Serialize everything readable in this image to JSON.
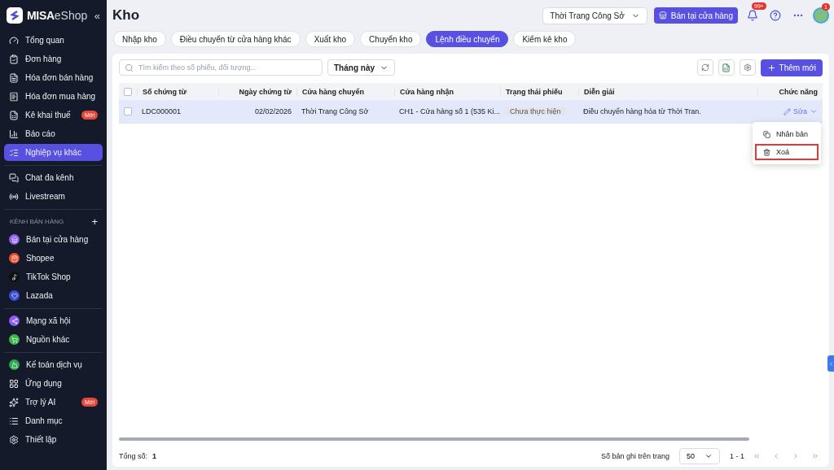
{
  "sidebar": {
    "logo": {
      "brand": "MISA",
      "product": "eShop"
    },
    "collapse": "«",
    "sections": [
      {
        "items": [
          {
            "label": "Tổng quan",
            "selected": false
          },
          {
            "label": "Đơn hàng",
            "selected": false
          },
          {
            "label": "Hóa đơn bán hàng",
            "selected": false
          },
          {
            "label": "Hóa đơn mua hàng",
            "selected": false
          },
          {
            "label": "Kê khai thuế",
            "selected": false,
            "badge": "Mới"
          },
          {
            "label": "Báo cáo",
            "selected": false
          },
          {
            "label": "Nghiệp vụ khác",
            "selected": true
          }
        ]
      },
      {
        "items": [
          {
            "label": "Chat đa kênh",
            "selected": false
          },
          {
            "label": "Livestream",
            "selected": false
          }
        ]
      },
      {
        "header": "KÊNH BÁN HÀNG",
        "add": "+",
        "items": [
          {
            "label": "Bán tại cửa hàng",
            "selected": false
          },
          {
            "label": "Shopee",
            "selected": false
          },
          {
            "label": "TikTok Shop",
            "selected": false
          },
          {
            "label": "Lazada",
            "selected": false
          }
        ]
      },
      {
        "items": [
          {
            "label": "Mạng xã hội",
            "selected": false
          },
          {
            "label": "Nguồn khác",
            "selected": false
          }
        ]
      },
      {
        "items": [
          {
            "label": "Kế toán dịch vụ",
            "selected": false
          },
          {
            "label": "Ứng dụng",
            "selected": false
          },
          {
            "label": "Trợ lý AI",
            "selected": false,
            "badge": "Mới"
          },
          {
            "label": "Danh mục",
            "selected": false
          },
          {
            "label": "Thiết lập",
            "selected": false
          }
        ]
      }
    ]
  },
  "header": {
    "title": "Kho",
    "store": "Thời Trang Công Sở",
    "pos_button": "Bán tại cửa hàng",
    "notifications": "99+",
    "avatar_badge": "1"
  },
  "tabs": [
    {
      "label": "Nhập kho",
      "selected": false
    },
    {
      "label": "Điều chuyển từ cửa hàng khác",
      "selected": false
    },
    {
      "label": "Xuất kho",
      "selected": false
    },
    {
      "label": "Chuyển kho",
      "selected": false
    },
    {
      "label": "Lệnh điều chuyển",
      "selected": true
    },
    {
      "label": "Kiểm kê kho",
      "selected": false
    }
  ],
  "toolbar": {
    "search": {
      "placeholder": "Tìm kiếm theo số phiếu, đối tượng..."
    },
    "period": "Tháng này",
    "add_button": "Thêm mới"
  },
  "table": {
    "checked_all": false,
    "columns": [
      "Số chứng từ",
      "Ngày chứng từ",
      "Cửa hàng chuyển",
      "Cửa hàng nhận",
      "Trạng thái phiếu",
      "Diễn giải",
      "Chức năng"
    ],
    "rows": [
      {
        "selected": true,
        "checked": false,
        "cells": [
          "LDC000001",
          "02/02/2026",
          "Thời Trang Công Sở",
          "CH1 - Cửa hàng số 1 (535 Ki...",
          "Chưa thực hiện",
          "Điều chuyển hàng hóa từ Thời Tran."
        ],
        "action": "Sửa"
      }
    ]
  },
  "row_menu": [
    {
      "label": "Nhân bản",
      "selected": false,
      "kind": "copy"
    },
    {
      "label": "Xoá",
      "selected": true,
      "kind": "delete"
    }
  ],
  "footer": {
    "total_label": "Tổng số:",
    "total": "1",
    "per_page_label": "Số bản ghi trên trang",
    "per_page": "50",
    "range": "1 - 1"
  }
}
